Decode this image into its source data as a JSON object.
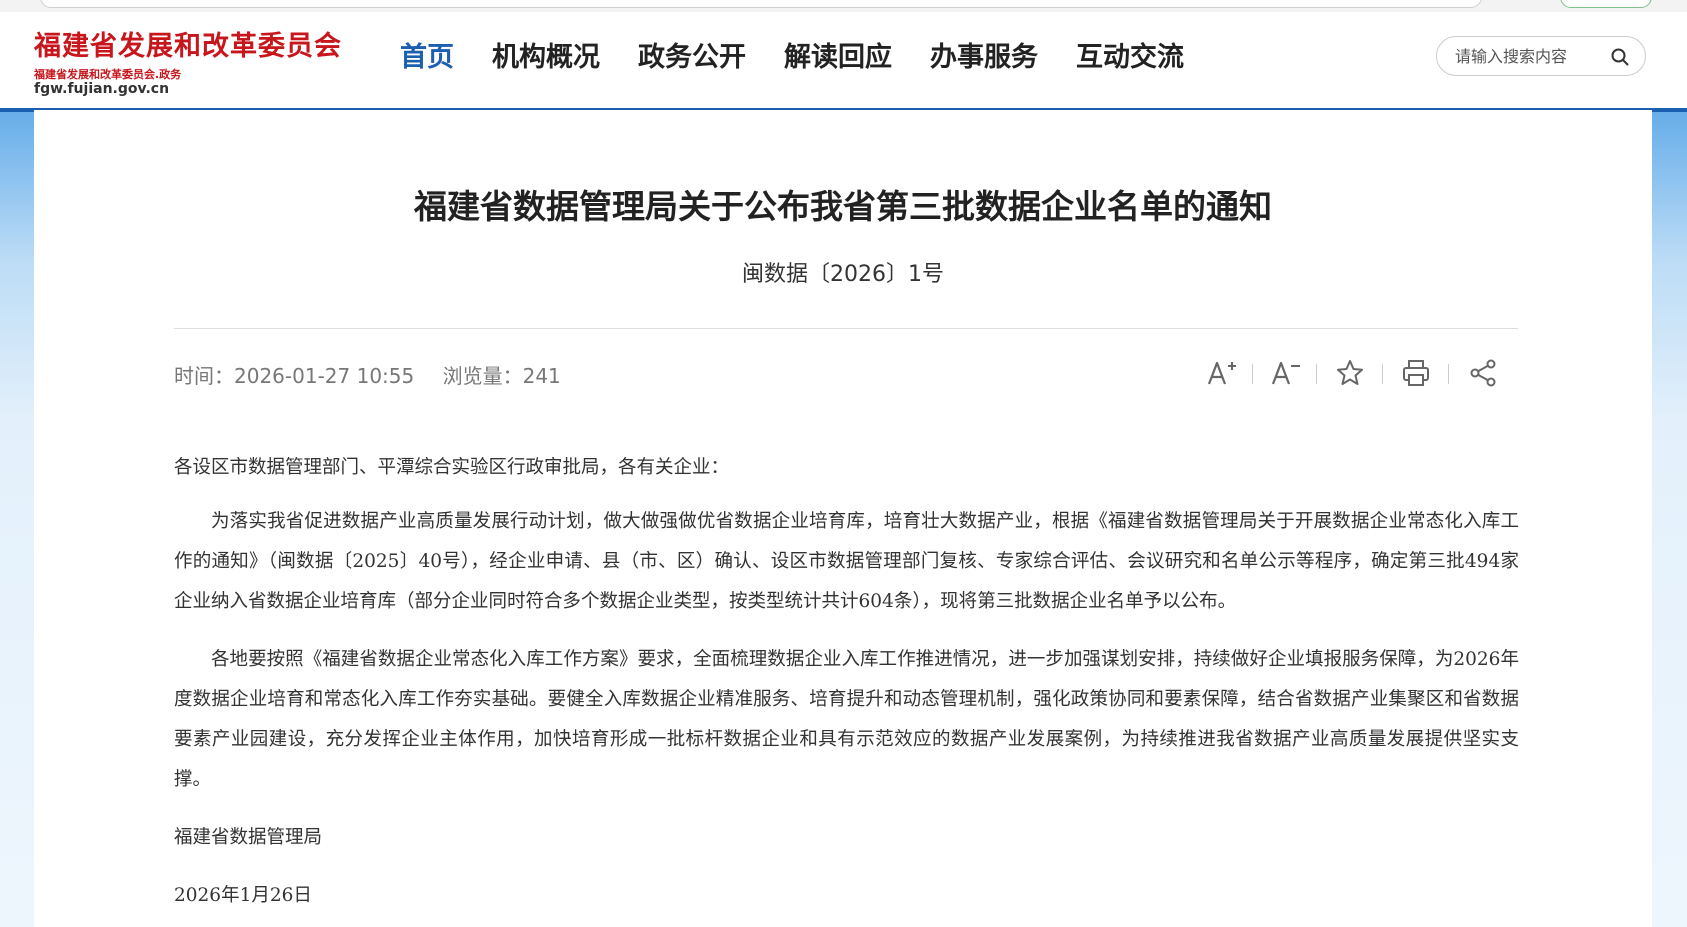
{
  "site": {
    "name": "福建省发展和改革委员会",
    "subname": "福建省发展和改革委员会.政务",
    "domain": "fgw.fujian.gov.cn"
  },
  "nav": {
    "items": [
      {
        "label": "首页",
        "active": true
      },
      {
        "label": "机构概况",
        "active": false
      },
      {
        "label": "政务公开",
        "active": false
      },
      {
        "label": "解读回应",
        "active": false
      },
      {
        "label": "办事服务",
        "active": false
      },
      {
        "label": "互动交流",
        "active": false
      }
    ]
  },
  "search": {
    "placeholder": "请输入搜索内容",
    "icon": "search-icon"
  },
  "article": {
    "title": "福建省数据管理局关于公布我省第三批数据企业名单的通知",
    "doc_number": "闽数据〔2026〕1号",
    "time_label": "时间：",
    "time": "2026-01-27 10:55",
    "views_label": "浏览量：",
    "views": "241",
    "tools": [
      "font-increase-icon",
      "font-decrease-icon",
      "star-icon",
      "print-icon",
      "share-icon"
    ],
    "salutation": "各设区市数据管理部门、平潭综合实验区行政审批局，各有关企业：",
    "paragraphs": [
      "为落实我省促进数据产业高质量发展行动计划，做大做强做优省数据企业培育库，培育壮大数据产业，根据《福建省数据管理局关于开展数据企业常态化入库工作的通知》（闽数据〔2025〕40号），经企业申请、县（市、区）确认、设区市数据管理部门复核、专家综合评估、会议研究和名单公示等程序，确定第三批494家企业纳入省数据企业培育库（部分企业同时符合多个数据企业类型，按类型统计共计604条），现将第三批数据企业名单予以公布。",
      "各地要按照《福建省数据企业常态化入库工作方案》要求，全面梳理数据企业入库工作推进情况，进一步加强谋划安排，持续做好企业填报服务保障，为2026年度数据企业培育和常态化入库工作夯实基础。要健全入库数据企业精准服务、培育提升和动态管理机制，强化政策协同和要素保障，结合省数据产业集聚区和省数据要素产业园建设，充分发挥企业主体作用，加快培育形成一批标杆数据企业和具有示范效应的数据产业发展案例，为持续推进我省数据产业高质量发展提供坚实支撑。"
    ],
    "signature": "福建省数据管理局",
    "date": "2026年1月26日"
  },
  "colors": {
    "brand_red": "#c8161d",
    "nav_active": "#1b5fb0",
    "background_blue": "#6bb0ea"
  }
}
